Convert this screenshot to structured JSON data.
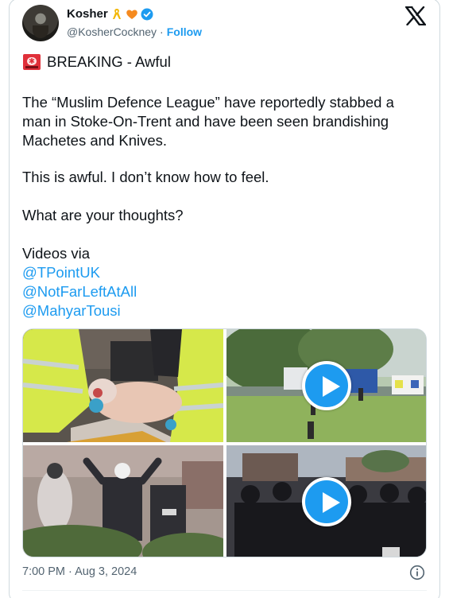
{
  "author": {
    "display_name": "Kosher",
    "handle": "@KosherCockney",
    "separator": "·",
    "follow_label": "Follow",
    "badges": [
      "yellow-ribbon-icon",
      "orange-heart-icon",
      "verified-badge-icon"
    ]
  },
  "platform_logo": "x-logo-icon",
  "tweet": {
    "breaking_icon": "police-siren-icon",
    "breaking_text": "BREAKING - Awful",
    "paragraph1_lines": [
      "The “Muslim Defence League” have reportedly stabbed a",
      "man in Stoke-On-Trent and have been seen brandishing",
      "Machetes and Knives."
    ],
    "paragraph2": "This is awful. I don’t know how to feel.",
    "paragraph3": "What are your thoughts?",
    "paragraph4_intro": "Videos via",
    "mentions": [
      "@TPointUK",
      "@NotFarLeftAtAll",
      "@MahyarTousi"
    ]
  },
  "media": [
    {
      "kind": "photo",
      "description_icon": "photo"
    },
    {
      "kind": "video",
      "play_icon": "play-icon"
    },
    {
      "kind": "photo",
      "description_icon": "photo"
    },
    {
      "kind": "video",
      "play_icon": "play-icon"
    }
  ],
  "footer": {
    "timestamp": "7:00 PM · Aug 3, 2024",
    "info_icon": "info-icon"
  },
  "colors": {
    "link": "#1d9bf0",
    "muted": "#536471",
    "text": "#0f1419",
    "border": "#cfd9de"
  }
}
